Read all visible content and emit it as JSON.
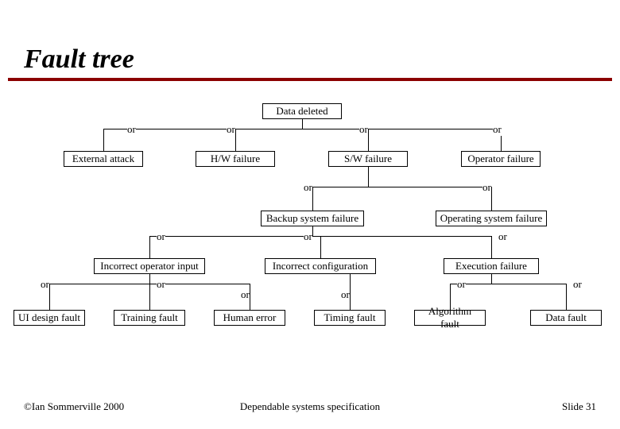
{
  "title": "Fault tree",
  "nodes": {
    "root": "Data deleted",
    "l1": {
      "external": "External attack",
      "hw": "H/W failure",
      "sw": "S/W failure",
      "op": "Operator failure"
    },
    "l2": {
      "backup": "Backup system failure",
      "os": "Operating system failure"
    },
    "l3": {
      "input": "Incorrect operator input",
      "config": "Incorrect configuration",
      "exec": "Execution failure"
    },
    "l4": {
      "ui": "UI design fault",
      "training": "Training fault",
      "human": "Human error",
      "timing": "Timing fault",
      "algo": "Algorithm fault",
      "data": "Data fault"
    }
  },
  "connector": "or",
  "footer": {
    "left": "©Ian Sommerville 2000",
    "center": "Dependable systems specification",
    "right": "Slide 31"
  }
}
